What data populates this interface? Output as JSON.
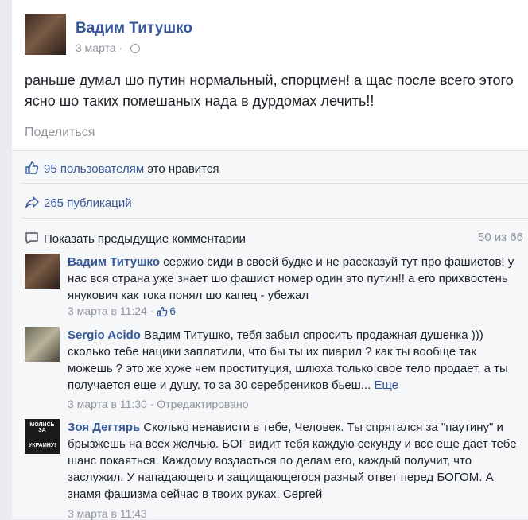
{
  "post": {
    "author": "Вадим Титушко",
    "date": "3 марта",
    "text": "раньше думал шо путин нормальный, спорцмен! а щас после всего этого ясно шо таких помешаных нада в дурдомах лечить!!",
    "share_label": "Поделиться"
  },
  "stats": {
    "likes_link": "95 пользователям",
    "likes_rest": " это нравится",
    "shares": "265 публикаций",
    "prev_comments": "Показать предыдущие комментарии",
    "count": "50 из 66"
  },
  "comments": [
    {
      "author": "Вадим Титушко",
      "text": " сержио сиди в своей будке и не рассказуй тут про фашистов! у нас вся страна уже знает шо фашист номер один это путин!! а его прихвостень янукович как тока понял шо капец - убежал",
      "date": "3 марта в 11:24",
      "likes": "6"
    },
    {
      "author": "Sergio Acido",
      "text": " Вадим Титушко, тебя забыл спросить продажная душенка ))) сколько тебе нацики заплатили, что бы ты их пиарил ? как ты вообще так можешь ? это же хуже чем проституция, шлюха только свое тело продает, а ты получается еще и душу. то за 30 серебреников бьеш...",
      "more": " Еще",
      "date": "3 марта в 11:30",
      "edited": "Отредактировано"
    },
    {
      "author": "Зоя Дегтярь",
      "text": " Сколько ненависти в тебе, Человек. Ты спрятался за \"паутину\" и брызжешь на всех желчью. БОГ видит тебя каждую секунду и все еще дает тебе шанс покаяться. Каждому воздасться по делам его, каждый получит, что заслужил. У нападающего и защищающегося разный ответ перед БОГОМ. А знамя фашизма сейчас в твоих руках, Сергей",
      "date": "3 марта в 11:43",
      "avatar_text_top": "МОЛИСЬ ЗА",
      "avatar_text_bottom": "УКРАИНУ!"
    }
  ],
  "colors": {
    "link": "#365899",
    "muted": "#90949c",
    "text": "#1d2129"
  }
}
